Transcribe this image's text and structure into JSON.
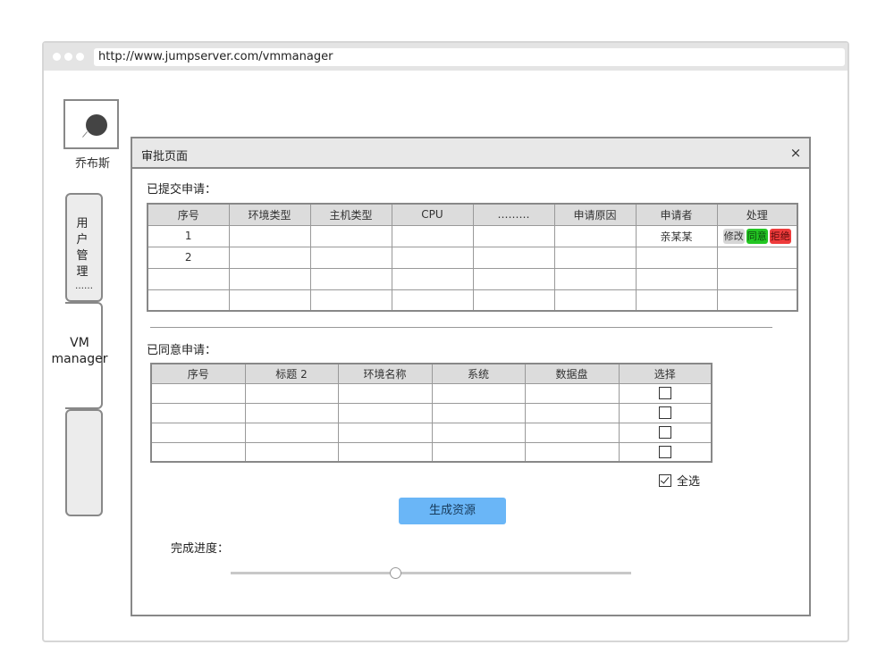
{
  "browser": {
    "url": "http://www.jumpserver.com/vmmanager"
  },
  "user": {
    "name": "乔布斯"
  },
  "nav": {
    "user_management": [
      "用",
      "户",
      "管",
      "理",
      "……"
    ],
    "vm_manager_line1": "VM",
    "vm_manager_line2": "manager"
  },
  "dialog": {
    "title": "审批页面",
    "close_label": "×",
    "submitted": {
      "label": "已提交申请：",
      "headers": [
        "序号",
        "环境类型",
        "主机类型",
        "CPU",
        "………",
        "申请原因",
        "申请者",
        "处理"
      ],
      "rows": [
        [
          "1",
          "",
          "",
          "",
          "",
          "",
          "亲某某",
          ""
        ],
        [
          "2",
          "",
          "",
          "",
          "",
          "",
          "",
          ""
        ],
        [
          "",
          "",
          "",
          "",
          "",
          "",
          "",
          ""
        ],
        [
          "",
          "",
          "",
          "",
          "",
          "",
          "",
          ""
        ]
      ],
      "actions": {
        "edit": "修改",
        "agree": "同意",
        "reject": "拒绝"
      }
    },
    "approved": {
      "label": "已同意申请：",
      "headers": [
        "序号",
        "标题 2",
        "环境名称",
        "系统",
        "数据盘",
        "选择"
      ],
      "row_count": 4,
      "select_all_label": "全选",
      "select_all_checked": true
    },
    "generate_button": "生成资源",
    "progress": {
      "label": "完成进度：",
      "value": 0.41
    }
  },
  "colors": {
    "agree": "#23c623",
    "reject": "#ee3b3b",
    "primary": "#6ab6f7"
  }
}
